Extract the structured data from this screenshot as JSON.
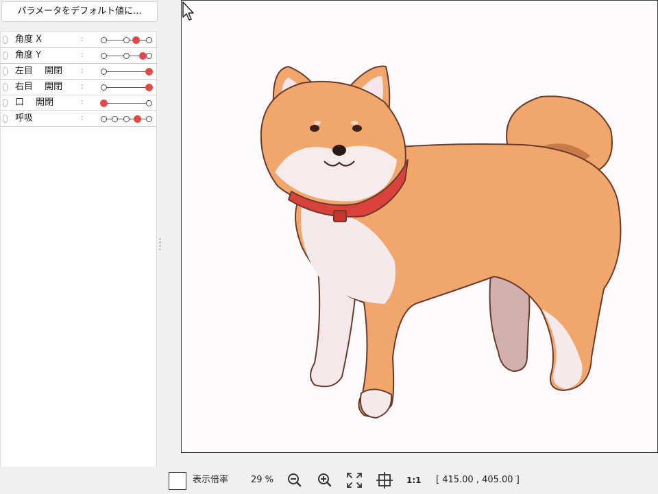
{
  "reset_button": "パラメータをデフォルト値に...",
  "params": [
    {
      "name": "角度 X",
      "keys": [
        0,
        0.5,
        1
      ],
      "value": 0.72
    },
    {
      "name": "角度 Y",
      "keys": [
        0,
        0.5,
        1
      ],
      "value": 0.87
    },
    {
      "name": "左目　 開閉",
      "keys": [
        0,
        1
      ],
      "value": 1.0
    },
    {
      "name": "右目　 開閉",
      "keys": [
        0,
        1
      ],
      "value": 1.0
    },
    {
      "name": "口　 開閉",
      "keys": [
        0,
        1
      ],
      "value": 0.0
    },
    {
      "name": "呼吸",
      "keys": [
        0,
        0.25,
        0.5,
        0.75,
        1
      ],
      "value": 0.75
    }
  ],
  "toolbar": {
    "zoom_label": "表示倍率",
    "zoom_value": "29 %",
    "ratio_label": "1:1",
    "coords": "[ 415.00 ,  405.00 ]"
  },
  "icons": {
    "zoom_out": "zoom-out-icon",
    "zoom_in": "zoom-in-icon",
    "fit": "fit-to-window-icon",
    "center": "center-target-icon"
  },
  "colors": {
    "knob": "#e34b4b",
    "fur": "#f1a66c",
    "collar": "#d9413a"
  }
}
